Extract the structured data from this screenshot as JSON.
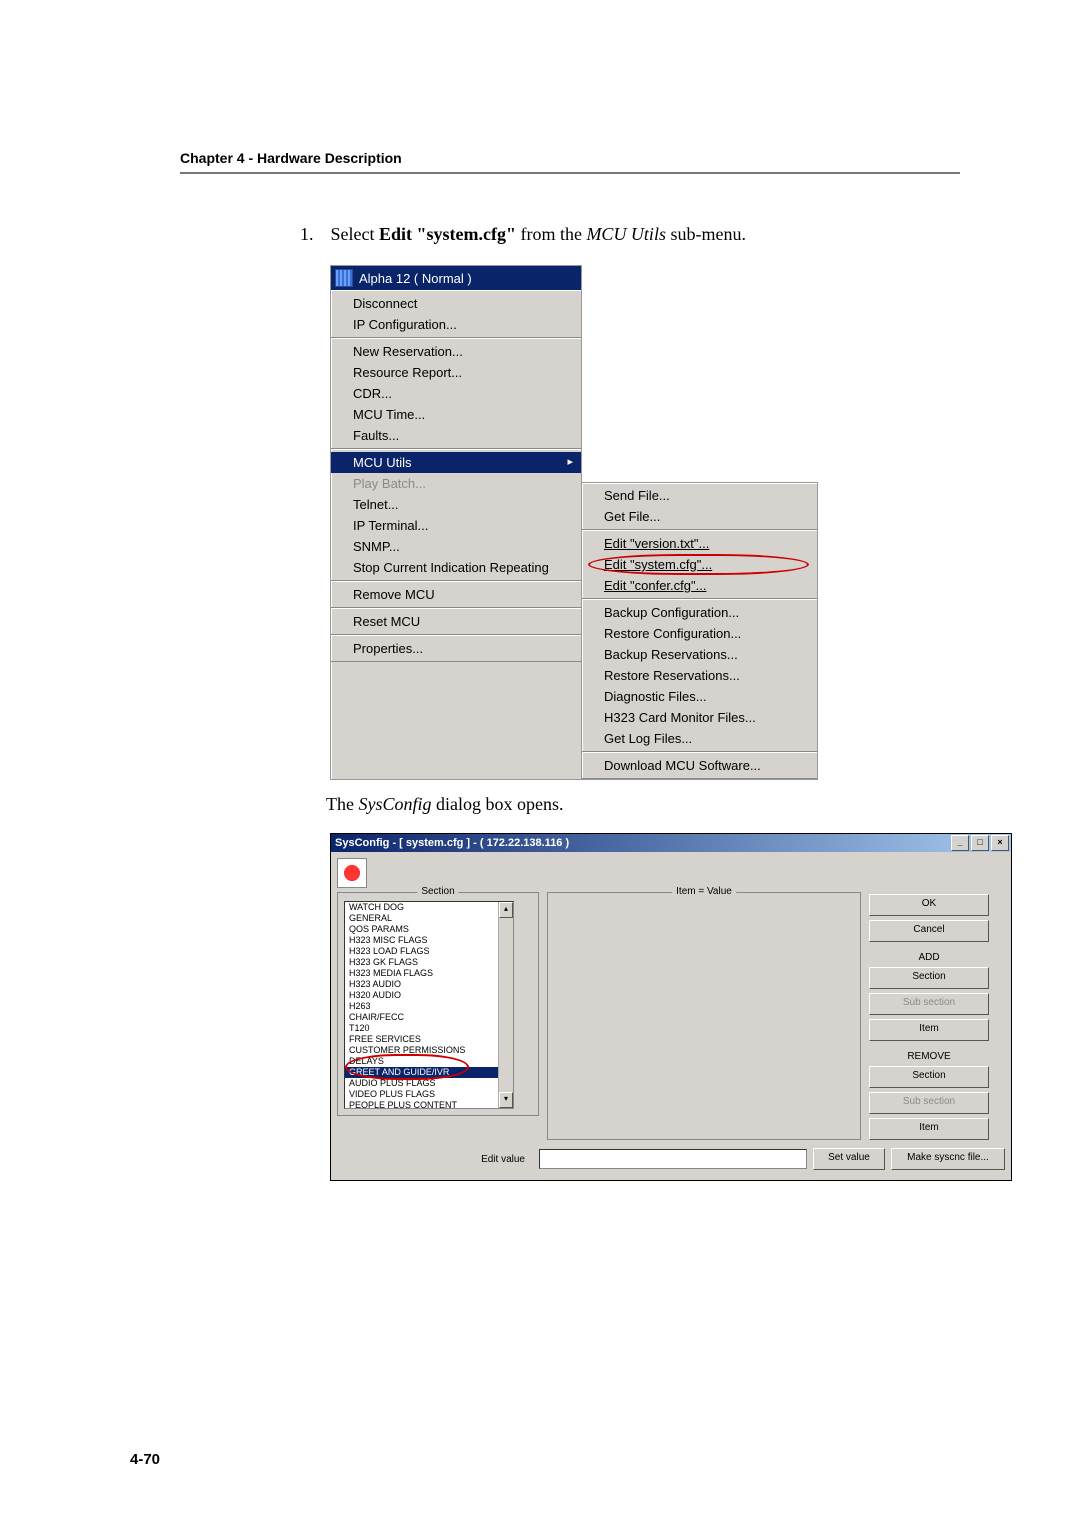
{
  "header": "Chapter 4 - Hardware Description",
  "step": {
    "num": "1.",
    "prefix": "Select ",
    "bold": "Edit \"system.cfg\"",
    "mid": " from the ",
    "italic": "MCU Utils",
    "suffix": " sub-menu."
  },
  "menu1": {
    "title": "Alpha 12   ( Normal )",
    "g1": [
      "Disconnect",
      "IP Configuration..."
    ],
    "g2": [
      "New Reservation...",
      "Resource Report...",
      "CDR...",
      "MCU Time...",
      "Faults..."
    ],
    "g3": {
      "hl": "MCU Utils",
      "rest": [
        "Play Batch...",
        "Telnet...",
        "IP Terminal...",
        "SNMP...",
        "Stop Current Indication Repeating"
      ]
    },
    "g4": [
      "Remove MCU"
    ],
    "g5": [
      "Reset MCU"
    ],
    "g6": [
      "Properties..."
    ]
  },
  "menu2": {
    "g1": [
      "Send File...",
      "Get File..."
    ],
    "g2": {
      "a": "Edit \"version.txt\"...",
      "b": "Edit \"system.cfg\"...",
      "c": "Edit \"confer.cfg\"..."
    },
    "g3": [
      "Backup Configuration...",
      "Restore Configuration...",
      "Backup Reservations...",
      "Restore Reservations...",
      "Diagnostic Files...",
      "H323 Card Monitor Files...",
      "Get Log Files..."
    ],
    "g4": [
      "Download MCU Software..."
    ]
  },
  "caption2_pre": "The ",
  "caption2_it": "SysConfig",
  "caption2_post": " dialog box opens.",
  "dlg": {
    "title": "SysConfig - [ system.cfg ] - ( 172.22.138.116 )",
    "section_legend": "Section",
    "item_legend": "Item = Value",
    "list": [
      "WATCH DOG",
      "GENERAL",
      "QOS PARAMS",
      "H323 MISC FLAGS",
      "H323 LOAD FLAGS",
      "H323 GK FLAGS",
      "H323 MEDIA FLAGS",
      "H323 AUDIO",
      "H320 AUDIO",
      "H263",
      "CHAIR/FECC",
      "T120",
      "FREE SERVICES",
      "CUSTOMER PERMISSIONS",
      "DELAYS",
      "GREET AND GUIDE/IVR",
      "AUDIO PLUS FLAGS",
      "VIDEO PLUS FLAGS",
      "PEOPLE PLUS CONTENT"
    ],
    "selected_index": 15,
    "btns": {
      "ok": "OK",
      "cancel": "Cancel",
      "add_label": "ADD",
      "add_section": "Section",
      "add_sub": "Sub section",
      "add_item": "Item",
      "rem_label": "REMOVE",
      "rem_section": "Section",
      "rem_sub": "Sub section",
      "rem_item": "Item"
    },
    "edit_label": "Edit value",
    "set_value": "Set value",
    "make_sys": "Make syscnc file..."
  },
  "page_num": "4-70"
}
